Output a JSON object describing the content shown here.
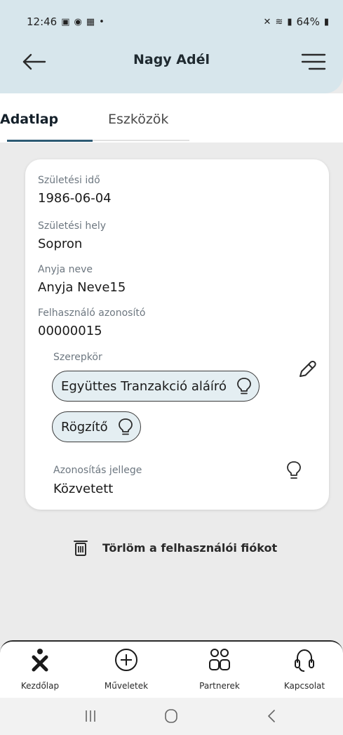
{
  "status_bar": {
    "time": "12:46",
    "battery": "64%"
  },
  "header": {
    "title": "Nagy Adél"
  },
  "tabs": [
    {
      "label": "Adatlap",
      "active": true
    },
    {
      "label": "Eszközök",
      "active": false
    }
  ],
  "profile": {
    "birth_date_label": "Születési idő",
    "birth_date": "1986-06-04",
    "birth_place_label": "Születési hely",
    "birth_place": "Sopron",
    "mother_name_label": "Anyja neve",
    "mother_name": "Anyja Neve15",
    "user_id_label": "Felhasználó azonosító",
    "user_id": "00000015",
    "roles_label": "Szerepkör",
    "roles": [
      "Együttes Tranzakció aláíró",
      "Rögzítő"
    ],
    "auth_type_label": "Azonosítás jellege",
    "auth_type": "Közvetett"
  },
  "actions": {
    "delete_account": "Törlöm a felhasználói fiókot"
  },
  "bottom_nav": [
    {
      "label": "Kezdőlap",
      "icon": "person-x-icon"
    },
    {
      "label": "Műveletek",
      "icon": "plus-circle-icon"
    },
    {
      "label": "Partnerek",
      "icon": "partners-icon"
    },
    {
      "label": "Kapcsolat",
      "icon": "headset-icon"
    }
  ],
  "colors": {
    "header_bg": "#d7e6ec",
    "chip_bg": "#e4eef2",
    "accent": "#2d5a73"
  }
}
